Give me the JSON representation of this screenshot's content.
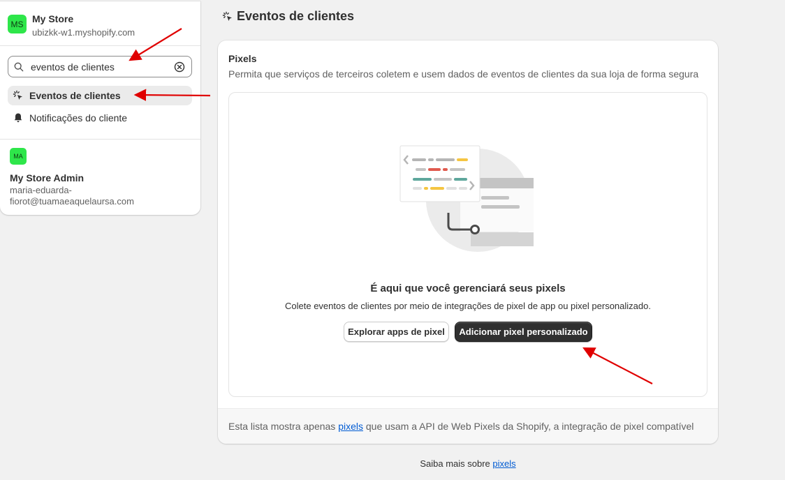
{
  "sidebar": {
    "store": {
      "initials": "MS",
      "name": "My Store",
      "domain": "ubizkk-w1.myshopify.com"
    },
    "search": {
      "value": "eventos de clientes",
      "placeholder": ""
    },
    "items": [
      {
        "label": "Eventos de clientes",
        "icon": "cursor-click-icon",
        "active": true
      },
      {
        "label": "Notificações do cliente",
        "icon": "bell-icon",
        "active": false
      }
    ],
    "admin": {
      "initials": "MA",
      "name": "My Store Admin",
      "email": "maria-eduarda-fiorot@tuamaeaquelaursa.com"
    }
  },
  "page": {
    "title": "Eventos de clientes",
    "title_icon": "cursor-click-icon"
  },
  "pixels_card": {
    "title": "Pixels",
    "description": "Permita que serviços de terceiros coletem e usem dados de eventos de clientes da sua loja de forma segura",
    "empty_state": {
      "heading": "É aqui que você gerenciará seus pixels",
      "description": "Colete eventos de clientes por meio de integrações de pixel de app ou pixel personalizado.",
      "secondary_button": "Explorar apps de pixel",
      "primary_button": "Adicionar pixel personalizado"
    },
    "footer": {
      "text_before": "Esta lista mostra apenas ",
      "link": "pixels",
      "text_after": " que usam a API de Web Pixels da Shopify, a integração de pixel compatível"
    }
  },
  "learn_more": {
    "text": "Saiba mais sobre ",
    "link": "pixels"
  },
  "colors": {
    "avatar_green": "#2ee64a",
    "primary_button": "#303030",
    "link": "#005bd3",
    "annotation_arrow": "#e00000"
  }
}
